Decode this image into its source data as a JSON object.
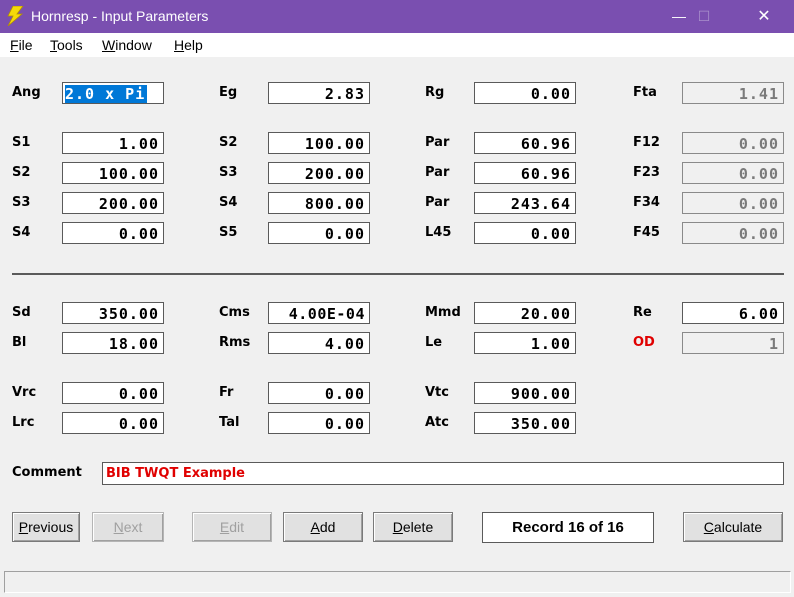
{
  "window": {
    "title": "Hornresp - Input Parameters",
    "minimize": "—",
    "maximize": "☐",
    "close": "✕"
  },
  "menu": [
    {
      "label": "File",
      "key": "F",
      "rest": "ile"
    },
    {
      "label": "Tools",
      "key": "T",
      "rest": "ools"
    },
    {
      "label": "Window",
      "key": "W",
      "rest": "indow"
    },
    {
      "label": "Help",
      "key": "H",
      "rest": "elp"
    }
  ],
  "fields": {
    "ang": {
      "label": "Ang",
      "value": "2.0 x Pi"
    },
    "eg": {
      "label": "Eg",
      "value": "2.83"
    },
    "rg": {
      "label": "Rg",
      "value": "0.00"
    },
    "fta": {
      "label": "Fta",
      "value": "1.41"
    },
    "s1": {
      "label": "S1",
      "value": "1.00"
    },
    "s2a": {
      "label": "S2",
      "value": "100.00"
    },
    "par1": {
      "label": "Par",
      "value": "60.96"
    },
    "f12": {
      "label": "F12",
      "value": "0.00"
    },
    "s2b": {
      "label": "S2",
      "value": "100.00"
    },
    "s3a": {
      "label": "S3",
      "value": "200.00"
    },
    "par2": {
      "label": "Par",
      "value": "60.96"
    },
    "f23": {
      "label": "F23",
      "value": "0.00"
    },
    "s3b": {
      "label": "S3",
      "value": "200.00"
    },
    "s4a": {
      "label": "S4",
      "value": "800.00"
    },
    "par3": {
      "label": "Par",
      "value": "243.64"
    },
    "f34": {
      "label": "F34",
      "value": "0.00"
    },
    "s4b": {
      "label": "S4",
      "value": "0.00"
    },
    "s5": {
      "label": "S5",
      "value": "0.00"
    },
    "l45": {
      "label": "L45",
      "value": "0.00"
    },
    "f45": {
      "label": "F45",
      "value": "0.00"
    },
    "sd": {
      "label": "Sd",
      "value": "350.00"
    },
    "cms": {
      "label": "Cms",
      "value": "4.00E-04"
    },
    "mmd": {
      "label": "Mmd",
      "value": "20.00"
    },
    "re": {
      "label": "Re",
      "value": "6.00"
    },
    "bl": {
      "label": "Bl",
      "value": "18.00"
    },
    "rms": {
      "label": "Rms",
      "value": "4.00"
    },
    "le": {
      "label": "Le",
      "value": "1.00"
    },
    "od": {
      "label": "OD",
      "value": "1"
    },
    "vrc": {
      "label": "Vrc",
      "value": "0.00"
    },
    "fr": {
      "label": "Fr",
      "value": "0.00"
    },
    "vtc": {
      "label": "Vtc",
      "value": "900.00"
    },
    "lrc": {
      "label": "Lrc",
      "value": "0.00"
    },
    "tal": {
      "label": "Tal",
      "value": "0.00"
    },
    "atc": {
      "label": "Atc",
      "value": "350.00"
    }
  },
  "comment": {
    "label": "Comment",
    "value": "BIB TWQT Example"
  },
  "buttons": {
    "previous": {
      "key": "P",
      "rest": "revious"
    },
    "next": {
      "key": "N",
      "rest": "ext"
    },
    "edit": {
      "key": "E",
      "rest": "dit"
    },
    "add": {
      "key": "A",
      "rest": "dd"
    },
    "delete": {
      "key": "D",
      "rest": "elete"
    },
    "calculate": {
      "key": "C",
      "rest": "alculate"
    }
  },
  "record": "Record 16 of 16",
  "colors": {
    "titlebar": "#7a4fb0",
    "selection": "#0078d7",
    "warning_red": "#e00000"
  }
}
